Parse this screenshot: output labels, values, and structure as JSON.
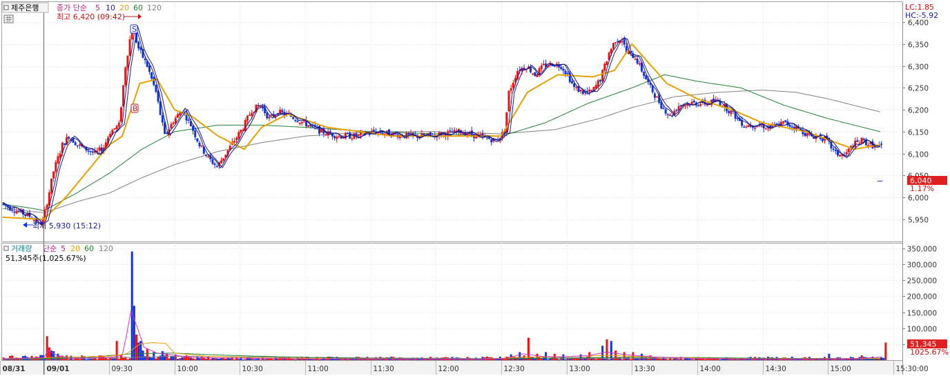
{
  "price_panel": {
    "stock_name": "제주은행",
    "ma_prefix": "종가 단순",
    "ma_labels": [
      "5",
      "10",
      "20",
      "60",
      "120"
    ],
    "high_label": "최고 6,420 (09:42)",
    "low_label": "최저 5,930 (15:12)",
    "lc_label": "LC:1.85",
    "hc_label": "HC:-5.92",
    "current_price_label": "6,040",
    "current_change_label": "1.17%",
    "signal_s": "S",
    "signal_b": "B"
  },
  "volume_panel": {
    "title": "거래량",
    "ma_prefix": "단순",
    "ma_labels": [
      "5",
      "20",
      "60",
      "120"
    ],
    "summary": "51,345주(1,025.67%)",
    "current_volume_label": "51,345",
    "current_ratio_label": "1025.67%"
  },
  "colors": {
    "up": "#ee1111",
    "down": "#1133dd",
    "ma5": "#1a1a80",
    "ma10": "#1a1a80",
    "ma20": "#e8a000",
    "ma60": "#208030",
    "ma120": "#808080",
    "vol_ma5": "#cc33cc",
    "vol_ma20": "#e8a000",
    "vol_ma60": "#208030",
    "vol_ma120": "#808080"
  },
  "chart_data": [
    {
      "type": "candlestick",
      "title": "제주은행",
      "y_ticks": [
        "6,400",
        "6,350",
        "6,300",
        "6,250",
        "6,200",
        "6,150",
        "6,100",
        "6,050",
        "6,000",
        "5,950"
      ],
      "ylim": [
        5900,
        6440
      ],
      "x_ticks": [
        "08/31",
        "09/01",
        "09:30",
        "10:00",
        "10:30",
        "11:00",
        "11:30",
        "12:00",
        "12:30",
        "13:00",
        "13:30",
        "14:00",
        "14:30",
        "15:00",
        "15:30:00"
      ],
      "x_tick_times": [
        -20,
        0,
        30,
        60,
        90,
        120,
        150,
        180,
        210,
        240,
        270,
        300,
        330,
        360,
        390
      ],
      "price_keypoints": [
        [
          -19,
          5985
        ],
        [
          -12,
          5970
        ],
        [
          -5,
          5955
        ],
        [
          -2,
          5940
        ],
        [
          0,
          5945
        ],
        [
          2,
          5990
        ],
        [
          5,
          6060
        ],
        [
          9,
          6120
        ],
        [
          12,
          6140
        ],
        [
          16,
          6120
        ],
        [
          20,
          6110
        ],
        [
          24,
          6100
        ],
        [
          28,
          6115
        ],
        [
          31,
          6150
        ],
        [
          35,
          6165
        ],
        [
          38,
          6300
        ],
        [
          41,
          6390
        ],
        [
          44,
          6340
        ],
        [
          48,
          6300
        ],
        [
          52,
          6240
        ],
        [
          56,
          6140
        ],
        [
          60,
          6175
        ],
        [
          64,
          6200
        ],
        [
          68,
          6165
        ],
        [
          72,
          6120
        ],
        [
          76,
          6090
        ],
        [
          80,
          6070
        ],
        [
          84,
          6100
        ],
        [
          88,
          6130
        ],
        [
          92,
          6160
        ],
        [
          96,
          6200
        ],
        [
          100,
          6210
        ],
        [
          104,
          6180
        ],
        [
          108,
          6195
        ],
        [
          114,
          6185
        ],
        [
          120,
          6170
        ],
        [
          128,
          6150
        ],
        [
          136,
          6140
        ],
        [
          144,
          6140
        ],
        [
          152,
          6150
        ],
        [
          160,
          6145
        ],
        [
          168,
          6140
        ],
        [
          176,
          6140
        ],
        [
          184,
          6145
        ],
        [
          192,
          6150
        ],
        [
          200,
          6140
        ],
        [
          208,
          6130
        ],
        [
          212,
          6150
        ],
        [
          214,
          6240
        ],
        [
          218,
          6290
        ],
        [
          222,
          6300
        ],
        [
          226,
          6280
        ],
        [
          230,
          6300
        ],
        [
          234,
          6305
        ],
        [
          238,
          6300
        ],
        [
          241,
          6280
        ],
        [
          244,
          6250
        ],
        [
          248,
          6240
        ],
        [
          252,
          6240
        ],
        [
          256,
          6270
        ],
        [
          260,
          6330
        ],
        [
          263,
          6360
        ],
        [
          266,
          6360
        ],
        [
          268,
          6330
        ],
        [
          272,
          6320
        ],
        [
          275,
          6290
        ],
        [
          279,
          6250
        ],
        [
          284,
          6210
        ],
        [
          288,
          6185
        ],
        [
          292,
          6210
        ],
        [
          298,
          6215
        ],
        [
          304,
          6215
        ],
        [
          310,
          6220
        ],
        [
          316,
          6195
        ],
        [
          322,
          6165
        ],
        [
          328,
          6165
        ],
        [
          334,
          6160
        ],
        [
          340,
          6170
        ],
        [
          346,
          6160
        ],
        [
          352,
          6140
        ],
        [
          356,
          6140
        ],
        [
          360,
          6130
        ],
        [
          364,
          6100
        ],
        [
          368,
          6095
        ],
        [
          372,
          6120
        ],
        [
          376,
          6130
        ],
        [
          380,
          6120
        ],
        [
          384,
          6115
        ]
      ],
      "ma_keypoints": {
        "ma20": [
          [
            -19,
            5955
          ],
          [
            0,
            5950
          ],
          [
            10,
            6000
          ],
          [
            30,
            6120
          ],
          [
            36,
            6140
          ],
          [
            44,
            6260
          ],
          [
            52,
            6270
          ],
          [
            60,
            6200
          ],
          [
            68,
            6185
          ],
          [
            80,
            6140
          ],
          [
            92,
            6110
          ],
          [
            100,
            6160
          ],
          [
            112,
            6190
          ],
          [
            130,
            6160
          ],
          [
            160,
            6140
          ],
          [
            190,
            6140
          ],
          [
            210,
            6140
          ],
          [
            222,
            6240
          ],
          [
            236,
            6280
          ],
          [
            252,
            6275
          ],
          [
            262,
            6290
          ],
          [
            270,
            6350
          ],
          [
            286,
            6260
          ],
          [
            300,
            6225
          ],
          [
            316,
            6200
          ],
          [
            330,
            6170
          ],
          [
            350,
            6150
          ],
          [
            372,
            6110
          ],
          [
            384,
            6120
          ]
        ],
        "ma60": [
          [
            -19,
            5985
          ],
          [
            -5,
            5975
          ],
          [
            0,
            5970
          ],
          [
            15,
            6010
          ],
          [
            30,
            6055
          ],
          [
            45,
            6110
          ],
          [
            60,
            6150
          ],
          [
            80,
            6165
          ],
          [
            100,
            6165
          ],
          [
            120,
            6160
          ],
          [
            150,
            6150
          ],
          [
            180,
            6145
          ],
          [
            210,
            6140
          ],
          [
            230,
            6170
          ],
          [
            250,
            6215
          ],
          [
            270,
            6250
          ],
          [
            285,
            6280
          ],
          [
            300,
            6265
          ],
          [
            320,
            6250
          ],
          [
            340,
            6210
          ],
          [
            360,
            6180
          ],
          [
            384,
            6150
          ]
        ],
        "ma120": [
          [
            -19,
            5975
          ],
          [
            0,
            5965
          ],
          [
            15,
            5990
          ],
          [
            30,
            6010
          ],
          [
            45,
            6045
          ],
          [
            60,
            6075
          ],
          [
            80,
            6105
          ],
          [
            100,
            6125
          ],
          [
            120,
            6140
          ],
          [
            150,
            6150
          ],
          [
            180,
            6150
          ],
          [
            210,
            6145
          ],
          [
            235,
            6155
          ],
          [
            255,
            6180
          ],
          [
            270,
            6205
          ],
          [
            290,
            6230
          ],
          [
            310,
            6240
          ],
          [
            330,
            6245
          ],
          [
            345,
            6240
          ],
          [
            360,
            6225
          ],
          [
            384,
            6195
          ]
        ]
      }
    },
    {
      "type": "bar",
      "title": "거래량",
      "y_ticks": [
        "350,000",
        "300,000",
        "250,000",
        "200,000",
        "150,000",
        "100,000",
        "50,000"
      ],
      "ylim": [
        0,
        350000
      ],
      "x_ticks": [
        "08/31",
        "09/01",
        "09:30",
        "10:00",
        "10:30",
        "11:00",
        "11:30",
        "12:00",
        "12:30",
        "13:00",
        "13:30",
        "14:00",
        "14:30",
        "15:00",
        "15:30:00"
      ],
      "volume_spikes": [
        [
          1,
          75000
        ],
        [
          2,
          40000
        ],
        [
          3,
          30000
        ],
        [
          4,
          28000
        ],
        [
          6,
          20000
        ],
        [
          10,
          15000
        ],
        [
          33,
          60000
        ],
        [
          40,
          340000
        ],
        [
          41,
          170000
        ],
        [
          42,
          80000
        ],
        [
          43,
          55000
        ],
        [
          44,
          60000
        ],
        [
          45,
          30000
        ],
        [
          47,
          35000
        ],
        [
          50,
          25000
        ],
        [
          54,
          28000
        ],
        [
          56,
          20000
        ],
        [
          60,
          18000
        ],
        [
          65,
          15000
        ],
        [
          75,
          12000
        ],
        [
          90,
          10000
        ],
        [
          100,
          9000
        ],
        [
          214,
          18000
        ],
        [
          218,
          25000
        ],
        [
          220,
          15000
        ],
        [
          222,
          70000
        ],
        [
          226,
          20000
        ],
        [
          230,
          25000
        ],
        [
          234,
          20000
        ],
        [
          238,
          18000
        ],
        [
          246,
          18000
        ],
        [
          250,
          25000
        ],
        [
          256,
          45000
        ],
        [
          258,
          65000
        ],
        [
          260,
          60000
        ],
        [
          262,
          30000
        ],
        [
          266,
          25000
        ],
        [
          270,
          25000
        ],
        [
          274,
          20000
        ],
        [
          278,
          15000
        ],
        [
          360,
          20000
        ],
        [
          375,
          15000
        ],
        [
          386,
          55000
        ]
      ],
      "ma_keypoints": {
        "vol_ma5": [
          [
            -19,
            4000
          ],
          [
            0,
            8000
          ],
          [
            2,
            30000
          ],
          [
            6,
            15000
          ],
          [
            12,
            6000
          ],
          [
            30,
            8000
          ],
          [
            36,
            15000
          ],
          [
            38,
            80000
          ],
          [
            40,
            155000
          ],
          [
            43,
            100000
          ],
          [
            46,
            40000
          ],
          [
            52,
            22000
          ],
          [
            60,
            15000
          ],
          [
            70,
            8000
          ],
          [
            90,
            6000
          ],
          [
            120,
            4000
          ],
          [
            200,
            3000
          ],
          [
            212,
            5000
          ],
          [
            220,
            20000
          ],
          [
            228,
            12000
          ],
          [
            236,
            10000
          ],
          [
            250,
            14000
          ],
          [
            258,
            25000
          ],
          [
            266,
            18000
          ],
          [
            280,
            10000
          ],
          [
            300,
            5000
          ],
          [
            340,
            3000
          ],
          [
            370,
            4000
          ],
          [
            386,
            10000
          ]
        ],
        "vol_ma20": [
          [
            -19,
            5000
          ],
          [
            0,
            7000
          ],
          [
            10,
            10000
          ],
          [
            30,
            12000
          ],
          [
            38,
            20000
          ],
          [
            44,
            50000
          ],
          [
            50,
            55000
          ],
          [
            56,
            52000
          ],
          [
            60,
            22000
          ],
          [
            75,
            12000
          ],
          [
            100,
            7000
          ],
          [
            150,
            3500
          ],
          [
            200,
            3000
          ],
          [
            220,
            9000
          ],
          [
            240,
            11000
          ],
          [
            260,
            15000
          ],
          [
            280,
            9000
          ],
          [
            320,
            4000
          ],
          [
            360,
            3500
          ],
          [
            386,
            6000
          ]
        ],
        "vol_ma60": [
          [
            -19,
            4000
          ],
          [
            0,
            5000
          ],
          [
            20,
            8000
          ],
          [
            40,
            20000
          ],
          [
            60,
            22000
          ],
          [
            80,
            16000
          ],
          [
            110,
            10000
          ],
          [
            150,
            5000
          ],
          [
            200,
            3500
          ],
          [
            240,
            7000
          ],
          [
            270,
            9000
          ],
          [
            300,
            8000
          ],
          [
            340,
            5000
          ],
          [
            386,
            4000
          ]
        ],
        "vol_ma120": [
          [
            -19,
            3000
          ],
          [
            0,
            4000
          ],
          [
            30,
            7000
          ],
          [
            60,
            12000
          ],
          [
            100,
            10000
          ],
          [
            150,
            7000
          ],
          [
            200,
            5000
          ],
          [
            250,
            6000
          ],
          [
            300,
            6000
          ],
          [
            386,
            5000
          ]
        ]
      }
    }
  ]
}
